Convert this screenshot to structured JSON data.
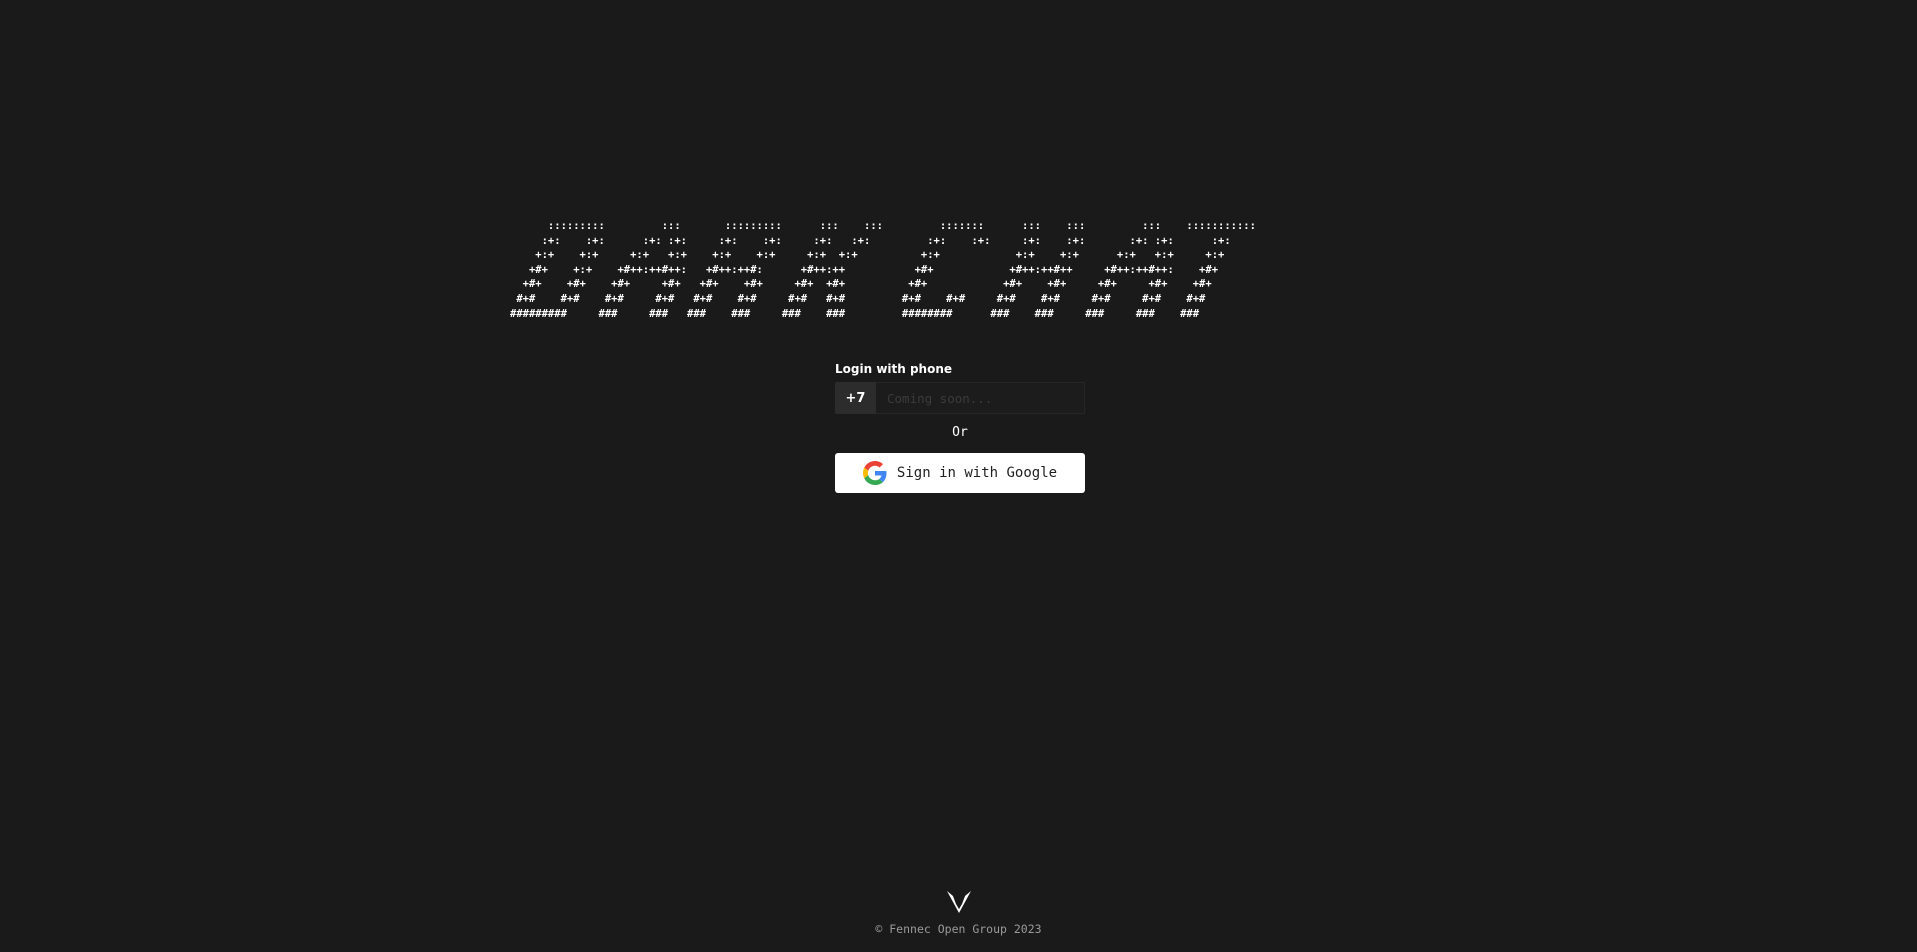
{
  "banner": {
    "ascii_art": "      :::::::::         :::       :::::::::      :::    :::         :::::::      :::    :::         :::    :::::::::::\n     :+:    :+:      :+: :+:     :+:    :+:     :+:   :+:         :+:    :+:     :+:    :+:       :+: :+:      :+:\n    +:+    +:+     +:+   +:+    +:+    +:+     +:+  +:+          +:+            +:+    +:+      +:+   +:+     +:+\n   +#+    +:+    +#++:++#++:   +#++:++#:      +#++:++           +#+            +#++:++#++     +#++:++#++:    +#+\n  +#+    +#+    +#+     +#+   +#+    +#+     +#+  +#+          +#+            +#+    +#+     +#+     +#+    +#+\n #+#    #+#    #+#     #+#   #+#    #+#     #+#   #+#         #+#    #+#     #+#    #+#     #+#     #+#    #+#\n#########     ###     ###   ###    ###     ###    ###         ########      ###    ###     ###     ###    ###"
  },
  "login": {
    "label": "Login with phone",
    "phone_prefix": "+7",
    "phone_placeholder": "Coming soon...",
    "or_text": "Or",
    "google_button_label": "Sign in with Google"
  },
  "footer": {
    "logo_icon": "fennec-logo-icon",
    "copyright": "© Fennec Open Group 2023"
  },
  "colors": {
    "background": "#1a1a1a",
    "text": "#ffffff",
    "muted": "#9a9a9a",
    "google_button_bg": "#ffffff"
  }
}
